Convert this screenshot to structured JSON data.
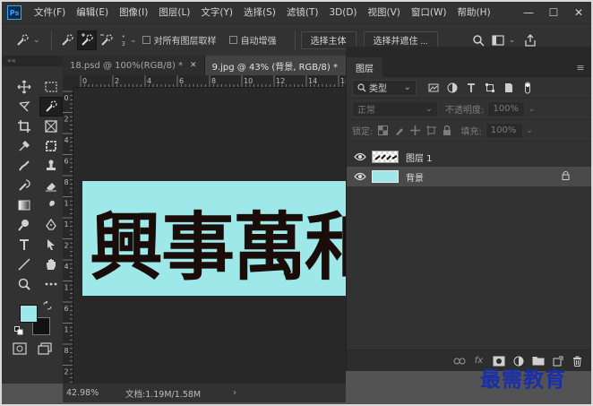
{
  "app": {
    "logo": "Ps"
  },
  "menu": [
    "文件(F)",
    "编辑(E)",
    "图像(I)",
    "图层(L)",
    "文字(Y)",
    "选择(S)",
    "滤镜(T)",
    "3D(D)",
    "视图(V)",
    "窗口(W)",
    "帮助(H)"
  ],
  "window_controls": {
    "minimize": "—",
    "restore": "☐",
    "close": "✕"
  },
  "options": {
    "brush_size": "3",
    "sample_all_layers": "对所有图层取样",
    "auto_enhance": "自动增强",
    "select_subject": "选择主体",
    "select_and_mask": "选择并遮住 ..."
  },
  "toolbar_collapse": "««",
  "tabs": [
    {
      "label": "18.psd @ 100%(RGB/8) *",
      "close": "✕",
      "active": false
    },
    {
      "label": "9.jpg @ 43% (背景, RGB/8) *",
      "close": "✕",
      "active": true
    }
  ],
  "ruler": {
    "top": [
      "0",
      "2",
      "4",
      "6",
      "8",
      "10",
      "12",
      "14",
      "16"
    ],
    "left": [
      "0",
      "2",
      "4",
      "6",
      "8",
      "1",
      "1",
      "2",
      "4",
      "1",
      "6",
      "1",
      "8",
      "2"
    ]
  },
  "document": {
    "calligraphy": "興事萬和"
  },
  "status": {
    "zoom": "42.98%",
    "doc_info": "文档:1.19M/1.58M",
    "arrow": "›"
  },
  "panel": {
    "tab": "图层",
    "menu_icon": "≡",
    "filter_kind": "类型",
    "blend_mode": "正常",
    "opacity_label": "不透明度:",
    "opacity_value": "100%",
    "lock_label": "锁定:",
    "fill_label": "填充:",
    "fill_value": "100%",
    "layers": [
      {
        "name": "图层 1",
        "selected": false,
        "locked": false
      },
      {
        "name": "背景",
        "selected": true,
        "locked": true
      }
    ],
    "footer_fx": "fx"
  },
  "colors": {
    "foreground": "#9ee8ea",
    "background": "#111111",
    "doc_bg": "#9ee8ea",
    "ps_accent": "#31a8ff"
  },
  "watermark": "最需教育"
}
